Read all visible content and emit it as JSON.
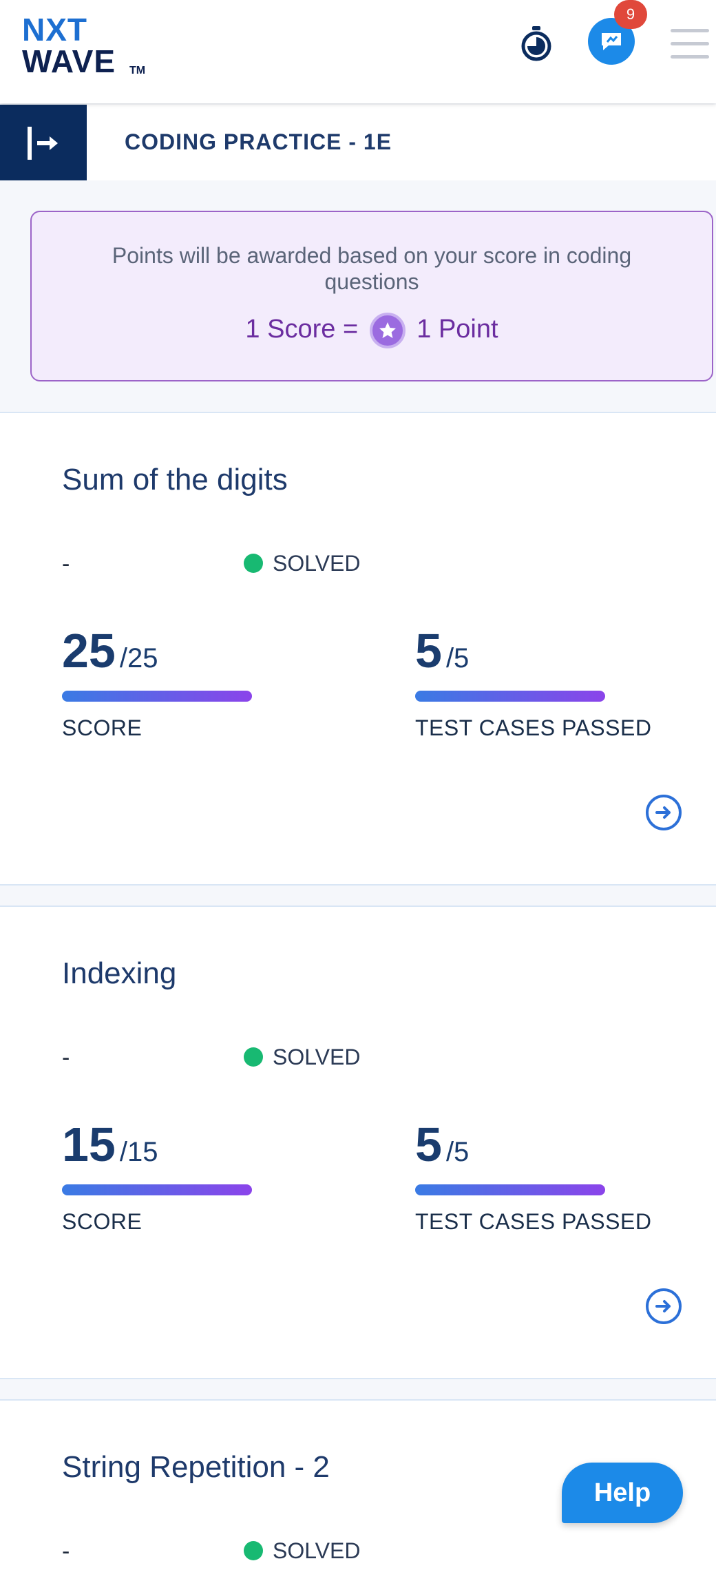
{
  "header": {
    "logo_line1": "NXT",
    "logo_line2": "WAVE",
    "logo_tm": "TM",
    "notification_count": "9",
    "icons": [
      "timer-icon",
      "chat-icon",
      "menu-icon"
    ]
  },
  "subheader": {
    "title": "CODING PRACTICE - 1E"
  },
  "points_banner": {
    "description": "Points will be awarded based on your score in coding questions",
    "eq_left": "1 Score =",
    "eq_right": "1 Point"
  },
  "questions": [
    {
      "title": "Sum of the digits",
      "dash": "-",
      "status": "SOLVED",
      "score": "25",
      "score_total": "/25",
      "score_label": "SCORE",
      "tests": "5",
      "tests_total": "/5",
      "tests_label": "TEST CASES PASSED",
      "score_fraction": 1.0,
      "tests_fraction": 1.0
    },
    {
      "title": "Indexing",
      "dash": "-",
      "status": "SOLVED",
      "score": "15",
      "score_total": "/15",
      "score_label": "SCORE",
      "tests": "5",
      "tests_total": "/5",
      "tests_label": "TEST CASES PASSED",
      "score_fraction": 1.0,
      "tests_fraction": 1.0
    },
    {
      "title": "String Repetition - 2",
      "dash": "-",
      "status": "SOLVED"
    }
  ],
  "help": {
    "label": "Help"
  },
  "colors": {
    "primary": "#1e3a6b",
    "accent_blue": "#1c8ae8",
    "solved_green": "#18b972",
    "badge_red": "#e0483b",
    "banner_purple": "#6b2da0"
  }
}
